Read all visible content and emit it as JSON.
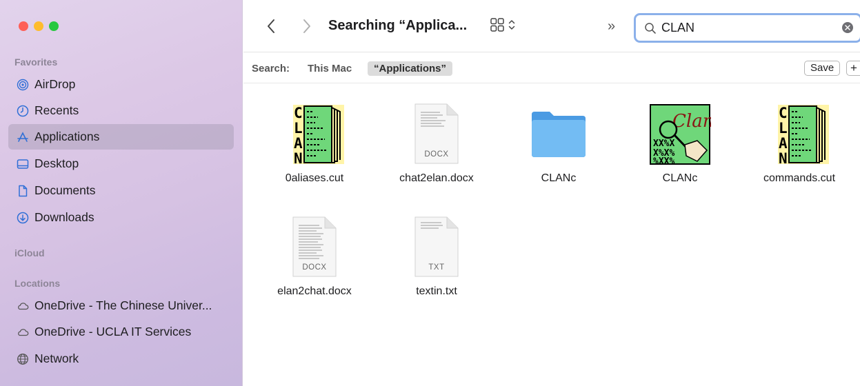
{
  "sidebar": {
    "favorites_header": "Favorites",
    "icloud_header": "iCloud",
    "locations_header": "Locations",
    "favorites": [
      {
        "label": "AirDrop",
        "icon": "airdrop-icon"
      },
      {
        "label": "Recents",
        "icon": "clock-icon"
      },
      {
        "label": "Applications",
        "icon": "applications-icon",
        "selected": true
      },
      {
        "label": "Desktop",
        "icon": "desktop-icon"
      },
      {
        "label": "Documents",
        "icon": "document-icon"
      },
      {
        "label": "Downloads",
        "icon": "download-icon"
      }
    ],
    "locations": [
      {
        "label": "OneDrive - The Chinese Univer...",
        "icon": "cloud-icon"
      },
      {
        "label": "OneDrive - UCLA IT Services",
        "icon": "cloud-icon"
      },
      {
        "label": "Network",
        "icon": "globe-icon"
      }
    ]
  },
  "toolbar": {
    "title": "Searching “Applica...",
    "overflow": "»",
    "search_value": "CLAN"
  },
  "scope": {
    "label": "Search:",
    "this_mac": "This Mac",
    "applications": "“Applications”",
    "save": "Save",
    "plus": "+"
  },
  "files": [
    {
      "name": "0aliases.cut",
      "kind": "clan-doc"
    },
    {
      "name": "chat2elan.docx",
      "kind": "docx",
      "badge": "DOCX"
    },
    {
      "name": "CLANc",
      "kind": "folder"
    },
    {
      "name": "CLANc",
      "kind": "clan-app",
      "logo_text": "Clan"
    },
    {
      "name": "commands.cut",
      "kind": "clan-doc"
    },
    {
      "name": "elan2chat.docx",
      "kind": "docx",
      "badge": "DOCX"
    },
    {
      "name": "textin.txt",
      "kind": "txt",
      "badge": "TXT"
    }
  ],
  "colors": {
    "sidebar_selected": "#a096af",
    "search_focus": "#8bb0ea",
    "folder_blue": "#5eaef0",
    "clan_green": "#6fd77a"
  }
}
